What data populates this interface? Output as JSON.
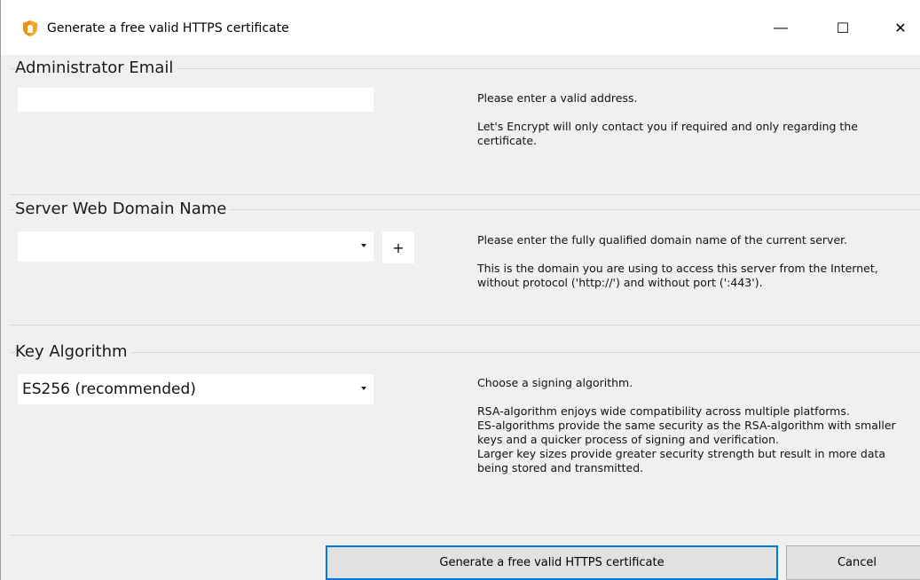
{
  "window": {
    "title": "Generate a free valid HTTPS certificate",
    "controls": {
      "minimize": "—",
      "maximize": "☐",
      "close": "✕"
    }
  },
  "email_group": {
    "title": "Administrator Email",
    "input_value": "",
    "desc1": "Please enter a valid address.",
    "desc2": "Let's Encrypt will only contact you if required and only regarding the certificate."
  },
  "domain_group": {
    "title": "Server Web Domain Name",
    "selected": "",
    "add_label": "+",
    "desc1": "Please enter the fully qualified domain name of the current server.",
    "desc2": "This is the domain you are using to access this server from the Internet, without protocol ('http://') and without port (':443')."
  },
  "key_group": {
    "title": "Key Algorithm",
    "selected": "ES256 (recommended)",
    "desc1": "Choose a signing algorithm.",
    "desc2": "RSA-algorithm enjoys wide compatibility across multiple platforms.",
    "desc3": "ES-algorithms provide the same security as the RSA-algorithm with smaller keys and a quicker process of signing and verification.",
    "desc4": "Larger key sizes provide greater security strength but result in more data being stored and transmitted."
  },
  "buttons": {
    "generate": "Generate a free valid HTTPS certificate",
    "cancel": "Cancel"
  },
  "colors": {
    "accent": "#0078d7",
    "shield": "#f5a623"
  },
  "icons": {
    "app": "shield-icon"
  }
}
